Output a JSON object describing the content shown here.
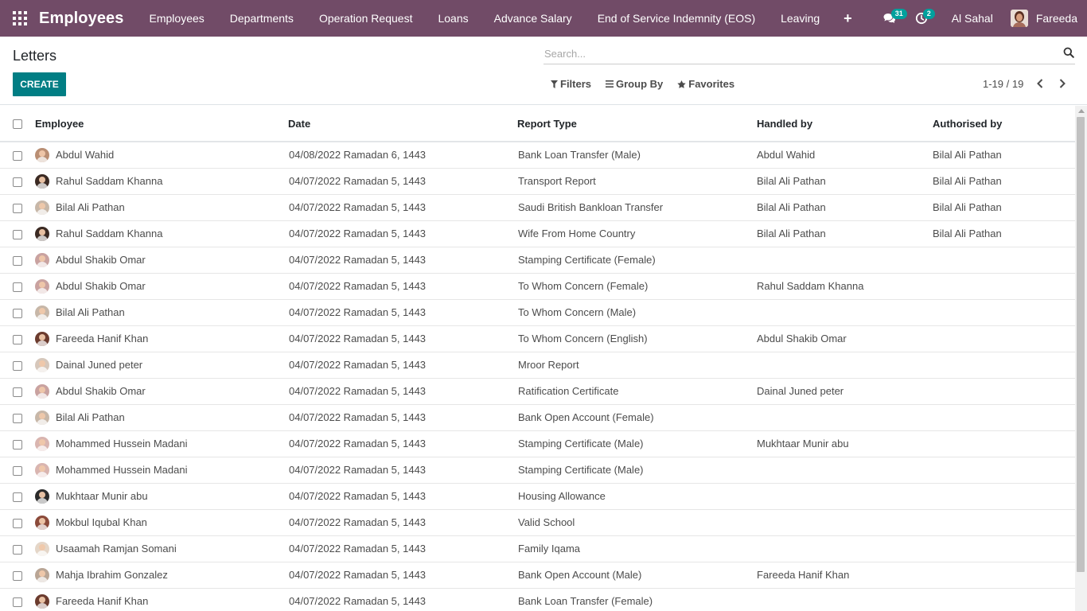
{
  "app": {
    "brand": "Employees",
    "menu": [
      "Employees",
      "Departments",
      "Operation Request",
      "Loans",
      "Advance Salary",
      "End of Service Indemnity (EOS)",
      "Leaving"
    ],
    "plus": "+",
    "messages_count": "31",
    "activities_count": "2",
    "company": "Al Sahal",
    "user": "Fareeda"
  },
  "control": {
    "title": "Letters",
    "create_label": "CREATE",
    "search_placeholder": "Search...",
    "filters_label": "Filters",
    "groupby_label": "Group By",
    "favorites_label": "Favorites",
    "pager": "1-19 / 19"
  },
  "table": {
    "headers": [
      "Employee",
      "Date",
      "Report Type",
      "Handled by",
      "Authorised by"
    ],
    "rows": [
      {
        "employee": "Abdul Wahid",
        "date": "04/08/2022 Ramadan 6, 1443",
        "report": "Bank Loan Transfer (Male)",
        "handled": "Abdul Wahid",
        "authorised": "Bilal Ali Pathan",
        "avatar_color": "#b98e73"
      },
      {
        "employee": "Rahul Saddam Khanna",
        "date": "04/07/2022 Ramadan 5, 1443",
        "report": "Transport Report",
        "handled": "Bilal Ali Pathan",
        "authorised": "Bilal Ali Pathan",
        "avatar_color": "#3b2a23"
      },
      {
        "employee": "Bilal Ali Pathan",
        "date": "04/07/2022 Ramadan 5, 1443",
        "report": "Saudi British Bankloan Transfer",
        "handled": "Bilal Ali Pathan",
        "authorised": "Bilal Ali Pathan",
        "avatar_color": "#c7b7a8"
      },
      {
        "employee": "Rahul Saddam Khanna",
        "date": "04/07/2022 Ramadan 5, 1443",
        "report": "Wife From Home Country",
        "handled": "Bilal Ali Pathan",
        "authorised": "Bilal Ali Pathan",
        "avatar_color": "#3b2a23"
      },
      {
        "employee": "Abdul Shakib Omar",
        "date": "04/07/2022 Ramadan 5, 1443",
        "report": "Stamping Certificate (Female)",
        "handled": "",
        "authorised": "",
        "avatar_color": "#c9a2a0"
      },
      {
        "employee": "Abdul Shakib Omar",
        "date": "04/07/2022 Ramadan 5, 1443",
        "report": "To Whom Concern (Female)",
        "handled": "Rahul Saddam Khanna",
        "authorised": "",
        "avatar_color": "#c9a2a0"
      },
      {
        "employee": "Bilal Ali Pathan",
        "date": "04/07/2022 Ramadan 5, 1443",
        "report": "To Whom Concern (Male)",
        "handled": "",
        "authorised": "",
        "avatar_color": "#c7b7a8"
      },
      {
        "employee": "Fareeda Hanif Khan",
        "date": "04/07/2022 Ramadan 5, 1443",
        "report": "To Whom Concern (English)",
        "handled": "Abdul Shakib Omar",
        "authorised": "",
        "avatar_color": "#6b3b2e"
      },
      {
        "employee": "Dainal Juned peter",
        "date": "04/07/2022 Ramadan 5, 1443",
        "report": "Mroor Report",
        "handled": "",
        "authorised": "",
        "avatar_color": "#d6c7bb"
      },
      {
        "employee": "Abdul Shakib Omar",
        "date": "04/07/2022 Ramadan 5, 1443",
        "report": "Ratification Certificate",
        "handled": "Dainal Juned peter",
        "authorised": "",
        "avatar_color": "#c9a2a0"
      },
      {
        "employee": "Bilal Ali Pathan",
        "date": "04/07/2022 Ramadan 5, 1443",
        "report": "Bank Open Account (Female)",
        "handled": "",
        "authorised": "",
        "avatar_color": "#c7b7a8"
      },
      {
        "employee": "Mohammed Hussein Madani",
        "date": "04/07/2022 Ramadan 5, 1443",
        "report": "Stamping Certificate (Male)",
        "handled": "Mukhtaar Munir abu",
        "authorised": "",
        "avatar_color": "#d9b5b0"
      },
      {
        "employee": "Mohammed Hussein Madani",
        "date": "04/07/2022 Ramadan 5, 1443",
        "report": "Stamping Certificate (Male)",
        "handled": "",
        "authorised": "",
        "avatar_color": "#d9b5b0"
      },
      {
        "employee": "Mukhtaar Munir abu",
        "date": "04/07/2022 Ramadan 5, 1443",
        "report": "Housing Allowance",
        "handled": "",
        "authorised": "",
        "avatar_color": "#2b2b2b"
      },
      {
        "employee": "Mokbul Iqubal Khan",
        "date": "04/07/2022 Ramadan 5, 1443",
        "report": "Valid School",
        "handled": "",
        "authorised": "",
        "avatar_color": "#8b4a3a"
      },
      {
        "employee": "Usaamah Ramjan Somani",
        "date": "04/07/2022 Ramadan 5, 1443",
        "report": "Family Iqama",
        "handled": "",
        "authorised": "",
        "avatar_color": "#e4d6c8"
      },
      {
        "employee": "Mahja Ibrahim Gonzalez",
        "date": "04/07/2022 Ramadan 5, 1443",
        "report": "Bank Open Account (Male)",
        "handled": "Fareeda Hanif Khan",
        "authorised": "",
        "avatar_color": "#b9a595"
      },
      {
        "employee": "Fareeda Hanif Khan",
        "date": "04/07/2022 Ramadan 5, 1443",
        "report": "Bank Loan Transfer (Female)",
        "handled": "",
        "authorised": "",
        "avatar_color": "#6b3b2e"
      }
    ]
  },
  "colors": {
    "navbar": "#714B67",
    "primary_button": "#017E84",
    "badge": "#00A09D"
  }
}
